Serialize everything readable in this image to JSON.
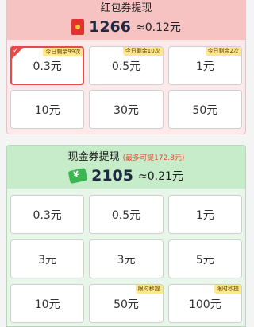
{
  "red_panel": {
    "title": "红包券提现",
    "amount": "1266",
    "approx": "≈0.12元",
    "options": [
      {
        "label": "0.3元",
        "badge": "今日剩余99次",
        "selected": true
      },
      {
        "label": "0.5元",
        "badge": "今日剩余10次",
        "selected": false
      },
      {
        "label": "1元",
        "badge": "今日剩余2次",
        "selected": false
      },
      {
        "label": "10元",
        "badge": "",
        "selected": false
      },
      {
        "label": "30元",
        "badge": "",
        "selected": false
      },
      {
        "label": "50元",
        "badge": "",
        "selected": false
      }
    ]
  },
  "cash_panel": {
    "title": "现金券提现",
    "limit": "(最多可提172.8元)",
    "amount": "2105",
    "approx": "≈0.21元",
    "options": [
      {
        "label": "0.3元",
        "badge": ""
      },
      {
        "label": "0.5元",
        "badge": ""
      },
      {
        "label": "1元",
        "badge": ""
      },
      {
        "label": "3元",
        "badge": ""
      },
      {
        "label": "3元",
        "badge": ""
      },
      {
        "label": "5元",
        "badge": ""
      },
      {
        "label": "10元",
        "badge": ""
      },
      {
        "label": "50元",
        "badge": "限时秒提"
      },
      {
        "label": "100元",
        "badge": "限时秒提"
      }
    ]
  },
  "colors": {
    "selected_border": "#e44b4b",
    "badge_bg": "#ffe78b"
  },
  "icons": {
    "red_packet": "red-packet-icon",
    "cash": "cash-bundle-icon",
    "check": "check-icon"
  }
}
